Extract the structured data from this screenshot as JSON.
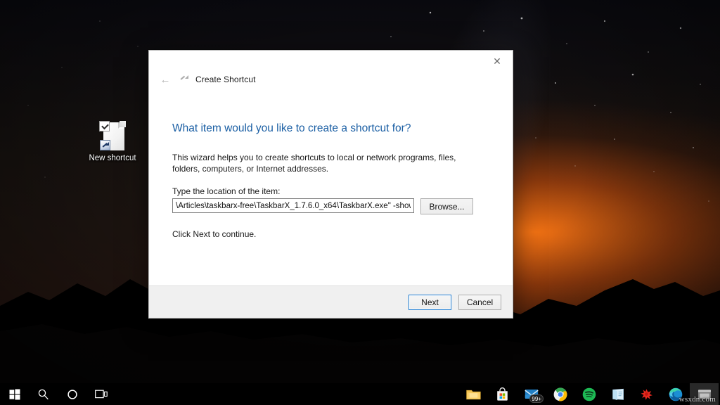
{
  "desktop": {
    "icon": {
      "label": "New shortcut",
      "glyph": "document-shortcut-icon"
    },
    "wallpaper_colors": {
      "sky_top": "#0a0a10",
      "horizon_glow": "#ff7814",
      "ridge": "#000000"
    }
  },
  "dialog": {
    "window_title": "Create Shortcut",
    "close_label": "✕",
    "back_label": "←",
    "heading": "What item would you like to create a shortcut for?",
    "paragraph": "This wizard helps you to create shortcuts to local or network programs, files, folders, computers, or Internet addresses.",
    "field_label": "Type the location of the item:",
    "location_value": "\\Articles\\taskbarx-free\\TaskbarX_1.7.6.0_x64\\TaskbarX.exe\" -showstartmenu",
    "location_placeholder": "Type the location of the item",
    "browse_label": "Browse...",
    "hint": "Click Next to continue.",
    "next_label": "Next",
    "cancel_label": "Cancel",
    "accent_color": "#1b5fa4",
    "default_button_border": "#1b7ad1"
  },
  "taskbar": {
    "background": "#000000",
    "left_buttons": [
      {
        "name": "start-button",
        "icon": "windows-logo-icon"
      },
      {
        "name": "search-button",
        "icon": "search-icon"
      },
      {
        "name": "cortana-button",
        "icon": "circle-icon"
      },
      {
        "name": "task-view-button",
        "icon": "task-view-icon"
      }
    ],
    "apps": [
      {
        "name": "file-explorer",
        "icon": "folder-icon",
        "badge": ""
      },
      {
        "name": "microsoft-store",
        "icon": "store-bag-icon",
        "badge": ""
      },
      {
        "name": "mail",
        "icon": "mail-icon",
        "badge": "99+"
      },
      {
        "name": "google-chrome",
        "icon": "chrome-icon",
        "badge": ""
      },
      {
        "name": "spotify",
        "icon": "spotify-icon",
        "badge": ""
      },
      {
        "name": "onenote",
        "icon": "onenote-icon",
        "badge": ""
      },
      {
        "name": "adobe-app",
        "icon": "red-splash-icon",
        "badge": ""
      },
      {
        "name": "microsoft-edge",
        "icon": "edge-icon",
        "badge": ""
      },
      {
        "name": "active-window",
        "icon": "window-icon",
        "badge": ""
      }
    ],
    "watermark": "wsxdn.com"
  }
}
